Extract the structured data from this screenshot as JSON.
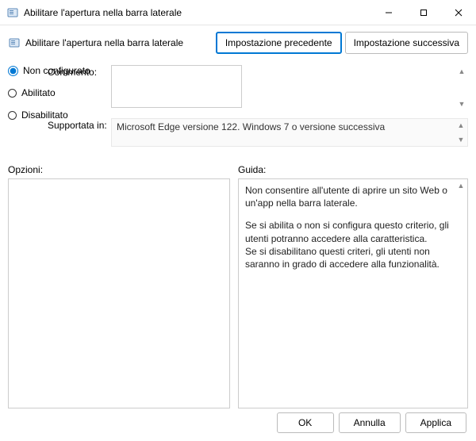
{
  "titlebar": {
    "title": "Abilitare l'apertura nella barra laterale"
  },
  "header": {
    "title": "Abilitare l'apertura nella barra laterale",
    "prev": "Impostazione precedente",
    "next": "Impostazione successiva"
  },
  "options": {
    "not_configured": "Non configurato",
    "enabled": "Abilitato",
    "disabled": "Disabilitato"
  },
  "labels": {
    "comment": "Commento:",
    "supported": "Supportata in:",
    "options": "Opzioni:",
    "guide": "Guida:"
  },
  "comment": "",
  "supported_text": "Microsoft Edge versione 122. Windows 7 o versione successiva",
  "guide": {
    "p1": "Non consentire all'utente di aprire un sito Web o un'app nella barra laterale.",
    "p2": "Se si abilita o non si configura questo criterio, gli utenti potranno accedere alla caratteristica.",
    "p3": "Se si disabilitano questi criteri, gli utenti non saranno in grado di accedere alla funzionalità."
  },
  "footer": {
    "ok": "OK",
    "cancel": "Annulla",
    "apply": "Applica"
  }
}
